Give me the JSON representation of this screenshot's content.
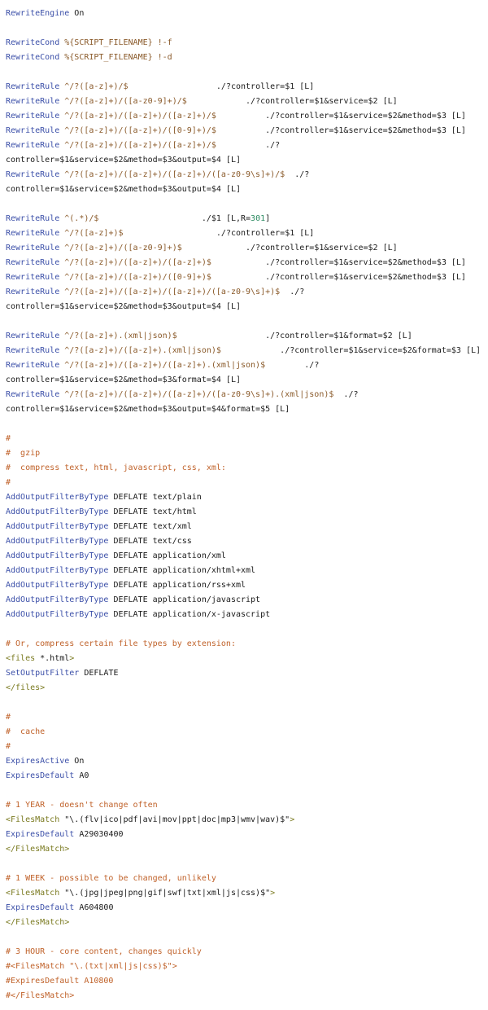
{
  "colors": {
    "kw": "#3b4fa8",
    "cm": "#c0622a",
    "tg": "#7a7a20",
    "rx": "#8a5a2a",
    "gr": "#2a8a60",
    "tx": "#1a1a1a",
    "background": "#ffffff"
  },
  "lines": [
    [
      [
        "kw",
        "RewriteEngine"
      ],
      [
        "tx",
        " On"
      ]
    ],
    [],
    [
      [
        "kw",
        "RewriteCond"
      ],
      [
        "rx",
        " %{SCRIPT_FILENAME} !-f"
      ]
    ],
    [
      [
        "kw",
        "RewriteCond"
      ],
      [
        "rx",
        " %{SCRIPT_FILENAME} !-d"
      ]
    ],
    [],
    [
      [
        "kw",
        "RewriteRule"
      ],
      [
        "rx",
        " ^/?([a-z]+)/$"
      ],
      [
        "tx",
        "                  ./?controller=$1 [L]"
      ]
    ],
    [
      [
        "kw",
        "RewriteRule"
      ],
      [
        "rx",
        " ^/?([a-z]+)/([a-z0-9]+)/$"
      ],
      [
        "tx",
        "            ./?controller=$1&service=$2 [L]"
      ]
    ],
    [
      [
        "kw",
        "RewriteRule"
      ],
      [
        "rx",
        " ^/?([a-z]+)/([a-z]+)/([a-z]+)/$"
      ],
      [
        "tx",
        "          ./?controller=$1&service=$2&method=$3 [L]"
      ]
    ],
    [
      [
        "kw",
        "RewriteRule"
      ],
      [
        "rx",
        " ^/?([a-z]+)/([a-z]+)/([0-9]+)/$"
      ],
      [
        "tx",
        "          ./?controller=$1&service=$2&method=$3 [L]"
      ]
    ],
    [
      [
        "kw",
        "RewriteRule"
      ],
      [
        "rx",
        " ^/?([a-z]+)/([a-z]+)/([a-z]+)/$"
      ],
      [
        "tx",
        "          ./?"
      ]
    ],
    [
      [
        "tx",
        "controller=$1&service=$2&method=$3&output=$4 [L]"
      ]
    ],
    [
      [
        "kw",
        "RewriteRule"
      ],
      [
        "rx",
        " ^/?([a-z]+)/([a-z]+)/([a-z]+)/([a-z0-9\\s]+)/$"
      ],
      [
        "tx",
        "  ./?"
      ]
    ],
    [
      [
        "tx",
        "controller=$1&service=$2&method=$3&output=$4 [L]"
      ]
    ],
    [],
    [
      [
        "kw",
        "RewriteRule"
      ],
      [
        "rx",
        " ^(.*)/$"
      ],
      [
        "tx",
        "                     ./$1 [L,R="
      ],
      [
        "gr",
        "301"
      ],
      [
        "tx",
        "]"
      ]
    ],
    [
      [
        "kw",
        "RewriteRule"
      ],
      [
        "rx",
        " ^/?([a-z]+)$"
      ],
      [
        "tx",
        "                   ./?controller=$1 [L]"
      ]
    ],
    [
      [
        "kw",
        "RewriteRule"
      ],
      [
        "rx",
        " ^/?([a-z]+)/([a-z0-9]+)$"
      ],
      [
        "tx",
        "             ./?controller=$1&service=$2 [L]"
      ]
    ],
    [
      [
        "kw",
        "RewriteRule"
      ],
      [
        "rx",
        " ^/?([a-z]+)/([a-z]+)/([a-z]+)$"
      ],
      [
        "tx",
        "           ./?controller=$1&service=$2&method=$3 [L]"
      ]
    ],
    [
      [
        "kw",
        "RewriteRule"
      ],
      [
        "rx",
        " ^/?([a-z]+)/([a-z]+)/([0-9]+)$"
      ],
      [
        "tx",
        "           ./?controller=$1&service=$2&method=$3 [L]"
      ]
    ],
    [
      [
        "kw",
        "RewriteRule"
      ],
      [
        "rx",
        " ^/?([a-z]+)/([a-z]+)/([a-z]+)/([a-z0-9\\s]+)$"
      ],
      [
        "tx",
        "  ./?"
      ]
    ],
    [
      [
        "tx",
        "controller=$1&service=$2&method=$3&output=$4 [L]"
      ]
    ],
    [],
    [
      [
        "kw",
        "RewriteRule"
      ],
      [
        "rx",
        " ^/?([a-z]+).(xml|json)$"
      ],
      [
        "tx",
        "                  ./?controller=$1&format=$2 [L]"
      ]
    ],
    [
      [
        "kw",
        "RewriteRule"
      ],
      [
        "rx",
        " ^/?([a-z]+)/([a-z]+).(xml|json)$"
      ],
      [
        "tx",
        "            ./?controller=$1&service=$2&format=$3 [L]"
      ]
    ],
    [
      [
        "kw",
        "RewriteRule"
      ],
      [
        "rx",
        " ^/?([a-z]+)/([a-z]+)/([a-z]+).(xml|json)$"
      ],
      [
        "tx",
        "        ./?"
      ]
    ],
    [
      [
        "tx",
        "controller=$1&service=$2&method=$3&format=$4 [L]"
      ]
    ],
    [
      [
        "kw",
        "RewriteRule"
      ],
      [
        "rx",
        " ^/?([a-z]+)/([a-z]+)/([a-z]+)/([a-z0-9\\s]+).(xml|json)$"
      ],
      [
        "tx",
        "  ./?"
      ]
    ],
    [
      [
        "tx",
        "controller=$1&service=$2&method=$3&output=$4&format=$5 [L]"
      ]
    ],
    [],
    [
      [
        "cm",
        "#"
      ]
    ],
    [
      [
        "cm",
        "#  gzip"
      ]
    ],
    [
      [
        "cm",
        "#  compress text, html, javascript, css, xml:"
      ]
    ],
    [
      [
        "cm",
        "#"
      ]
    ],
    [
      [
        "kw",
        "AddOutputFilterByType"
      ],
      [
        "tx",
        " DEFLATE text/plain"
      ]
    ],
    [
      [
        "kw",
        "AddOutputFilterByType"
      ],
      [
        "tx",
        " DEFLATE text/html"
      ]
    ],
    [
      [
        "kw",
        "AddOutputFilterByType"
      ],
      [
        "tx",
        " DEFLATE text/xml"
      ]
    ],
    [
      [
        "kw",
        "AddOutputFilterByType"
      ],
      [
        "tx",
        " DEFLATE text/css"
      ]
    ],
    [
      [
        "kw",
        "AddOutputFilterByType"
      ],
      [
        "tx",
        " DEFLATE application/xml"
      ]
    ],
    [
      [
        "kw",
        "AddOutputFilterByType"
      ],
      [
        "tx",
        " DEFLATE application/xhtml+xml"
      ]
    ],
    [
      [
        "kw",
        "AddOutputFilterByType"
      ],
      [
        "tx",
        " DEFLATE application/rss+xml"
      ]
    ],
    [
      [
        "kw",
        "AddOutputFilterByType"
      ],
      [
        "tx",
        " DEFLATE application/javascript"
      ]
    ],
    [
      [
        "kw",
        "AddOutputFilterByType"
      ],
      [
        "tx",
        " DEFLATE application/x-javascript"
      ]
    ],
    [],
    [
      [
        "cm",
        "# Or, compress certain file types by extension:"
      ]
    ],
    [
      [
        "tg",
        "<files"
      ],
      [
        "tx",
        " *.html"
      ],
      [
        "tg",
        ">"
      ]
    ],
    [
      [
        "kw",
        "SetOutputFilter"
      ],
      [
        "tx",
        " DEFLATE"
      ]
    ],
    [
      [
        "tg",
        "</files>"
      ]
    ],
    [],
    [
      [
        "cm",
        "#"
      ]
    ],
    [
      [
        "cm",
        "#  cache"
      ]
    ],
    [
      [
        "cm",
        "#"
      ]
    ],
    [
      [
        "kw",
        "ExpiresActive"
      ],
      [
        "tx",
        " On"
      ]
    ],
    [
      [
        "kw",
        "ExpiresDefault"
      ],
      [
        "tx",
        " A0"
      ]
    ],
    [],
    [
      [
        "cm",
        "# 1 YEAR - doesn't change often"
      ]
    ],
    [
      [
        "tg",
        "<FilesMatch"
      ],
      [
        "tx",
        " \"\\.(flv|ico|pdf|avi|mov|ppt|doc|mp3|wmv|wav)$\""
      ],
      [
        "tg",
        ">"
      ]
    ],
    [
      [
        "kw",
        "ExpiresDefault"
      ],
      [
        "tx",
        " A29030400"
      ]
    ],
    [
      [
        "tg",
        "</FilesMatch>"
      ]
    ],
    [],
    [
      [
        "cm",
        "# 1 WEEK - possible to be changed, unlikely"
      ]
    ],
    [
      [
        "tg",
        "<FilesMatch"
      ],
      [
        "tx",
        " \"\\.(jpg|jpeg|png|gif|swf|txt|xml|js|css)$\""
      ],
      [
        "tg",
        ">"
      ]
    ],
    [
      [
        "kw",
        "ExpiresDefault"
      ],
      [
        "tx",
        " A604800"
      ]
    ],
    [
      [
        "tg",
        "</FilesMatch>"
      ]
    ],
    [],
    [
      [
        "cm",
        "# 3 HOUR - core content, changes quickly"
      ]
    ],
    [
      [
        "cm",
        "#<FilesMatch \"\\.(txt|xml|js|css)$\">"
      ]
    ],
    [
      [
        "cm",
        "#ExpiresDefault A10800"
      ]
    ],
    [
      [
        "cm",
        "#</FilesMatch>"
      ]
    ]
  ]
}
